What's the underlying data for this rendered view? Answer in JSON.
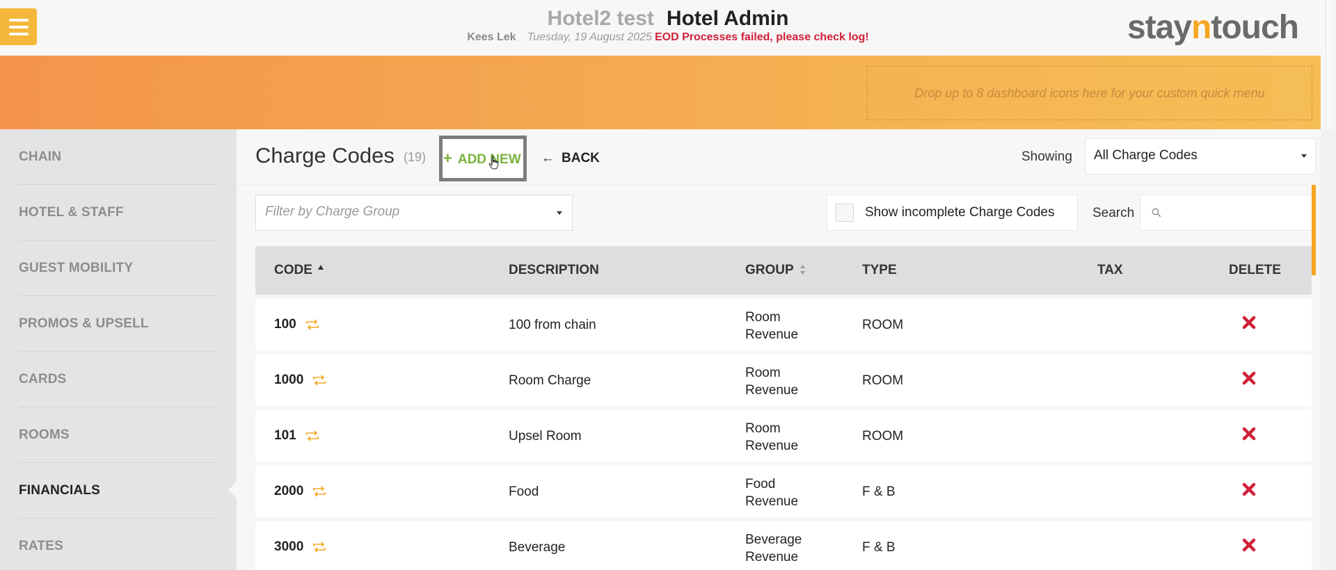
{
  "header": {
    "hotel_name": "Hotel2 test",
    "app_title": "Hotel Admin",
    "user": "Kees Lek",
    "date": "Tuesday, 19 August 2025",
    "error_message": "EOD Processes failed, please check log!",
    "logo_part1": "stay",
    "logo_part2": "n",
    "logo_part3": "touch"
  },
  "banner": {
    "drop_zone_text": "Drop up to 8 dashboard icons here for your custom quick menu"
  },
  "sidebar": {
    "items": [
      {
        "label": "CHAIN"
      },
      {
        "label": "HOTEL & STAFF"
      },
      {
        "label": "GUEST MOBILITY"
      },
      {
        "label": "PROMOS & UPSELL"
      },
      {
        "label": "CARDS"
      },
      {
        "label": "ROOMS"
      },
      {
        "label": "FINANCIALS",
        "active": true
      },
      {
        "label": "RATES"
      }
    ]
  },
  "main": {
    "title": "Charge Codes",
    "count": "(19)",
    "add_new_label": "ADD NEW",
    "back_label": "BACK",
    "showing_label": "Showing",
    "showing_value": "All Charge Codes",
    "filter_placeholder": "Filter by Charge Group",
    "incomplete_label": "Show incomplete Charge Codes",
    "search_label": "Search"
  },
  "table": {
    "columns": [
      "CODE",
      "DESCRIPTION",
      "GROUP",
      "TYPE",
      "TAX",
      "DELETE"
    ],
    "rows": [
      {
        "code": "100",
        "description": "100 from chain",
        "group_line1": "Room",
        "group_line2": "Revenue",
        "type": "ROOM",
        "tax": ""
      },
      {
        "code": "1000",
        "description": "Room Charge",
        "group_line1": "Room",
        "group_line2": "Revenue",
        "type": "ROOM",
        "tax": ""
      },
      {
        "code": "101",
        "description": "Upsel Room",
        "group_line1": "Room",
        "group_line2": "Revenue",
        "type": "ROOM",
        "tax": ""
      },
      {
        "code": "2000",
        "description": "Food",
        "group_line1": "Food",
        "group_line2": "Revenue",
        "type": "F & B",
        "tax": ""
      },
      {
        "code": "3000",
        "description": "Beverage",
        "group_line1": "Beverage",
        "group_line2": "Revenue",
        "type": "F & B",
        "tax": ""
      }
    ]
  },
  "colors": {
    "accent_orange": "#f5a623",
    "add_new_green": "#78b23c",
    "error_red": "#d0213a",
    "delete_red": "#d0213a"
  },
  "icons": {
    "menu": "hamburger-icon",
    "back": "arrow-left-icon",
    "add": "plus-icon",
    "search": "search-icon",
    "recurring": "repeat-icon",
    "delete": "close-x-icon"
  }
}
